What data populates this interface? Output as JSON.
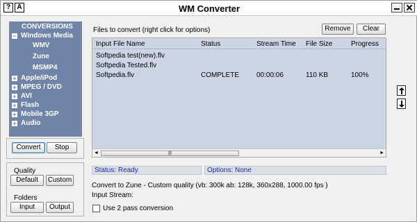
{
  "window": {
    "title": "WM Converter",
    "help_button": "?",
    "about_button": "A"
  },
  "sidebar": {
    "header": "CONVERSIONS",
    "categories": [
      {
        "label": "Windows Media",
        "expander": "−",
        "children": [
          "WMV",
          "Zune",
          "MSMP4"
        ]
      },
      {
        "label": "Apple/iPod",
        "expander": "+"
      },
      {
        "label": "MPEG / DVD",
        "expander": "+"
      },
      {
        "label": "AVI",
        "expander": "+"
      },
      {
        "label": "Flash",
        "expander": "+"
      },
      {
        "label": "Mobile 3GP",
        "expander": "+"
      },
      {
        "label": "Audio",
        "expander": "+"
      }
    ],
    "convert_label": "Convert",
    "stop_label": "Stop",
    "quality_label": "Quality",
    "default_label": "Default",
    "custom_label": "Custom",
    "folders_label": "Folders",
    "input_label": "Input",
    "output_label": "Output"
  },
  "files": {
    "label": "Files to convert (right click for options)",
    "remove_label": "Remove",
    "clear_label": "Clear",
    "columns": [
      "Input File Name",
      "Status",
      "Stream Time",
      "File Size",
      "Progress"
    ],
    "rows": [
      {
        "name": "Softpedia test(new).flv",
        "status": "",
        "time": "",
        "size": "",
        "progress": ""
      },
      {
        "name": "Softpedia Tested.flv",
        "status": "",
        "time": "",
        "size": "",
        "progress": ""
      },
      {
        "name": "Softpedia.flv",
        "status": "COMPLETE",
        "time": "00:00:06",
        "size": "110 KB",
        "progress": "100%"
      }
    ],
    "scroll_left": "◄",
    "scroll_right": "►",
    "scroll_grip": "|||"
  },
  "status": {
    "status_text": "Status: Ready",
    "options_text": "Options: None"
  },
  "info": {
    "convert_line": "Convert to Zune - Custom quality (vb: 300k ab: 128k, 360x288, 1000.00 fps )",
    "input_stream": "Input Stream:",
    "two_pass_label": "Use 2 pass conversion"
  }
}
